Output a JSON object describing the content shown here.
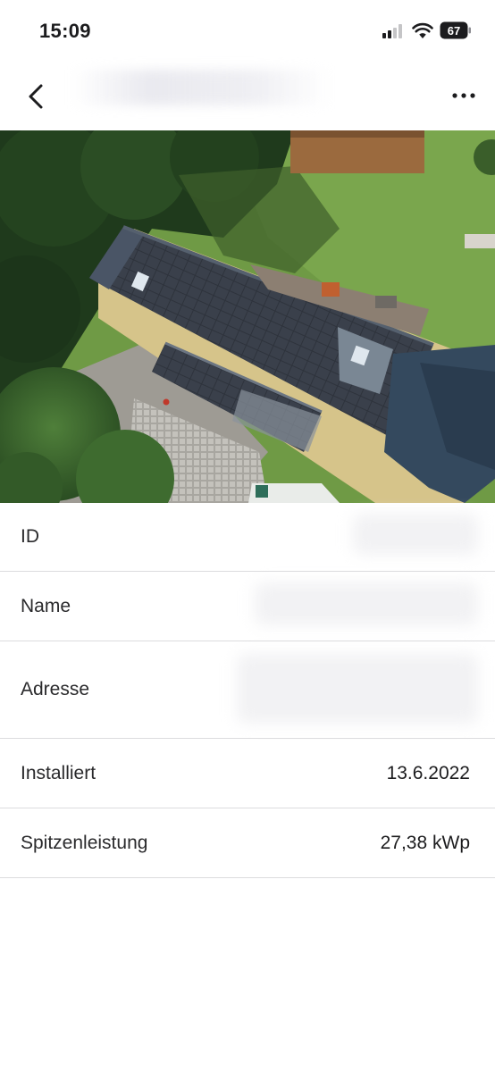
{
  "status_bar": {
    "time": "15:09",
    "battery_level": "67",
    "signal_bars_active": 2,
    "signal_bars_total": 4
  },
  "nav": {
    "back_icon": "chevron-left-icon",
    "more_icon": "ellipsis-icon"
  },
  "hero": {
    "icon": "photo"
  },
  "details": {
    "rows": [
      {
        "label": "ID",
        "value": ""
      },
      {
        "label": "Name",
        "value": ""
      },
      {
        "label": "Adresse",
        "value": ""
      },
      {
        "label": "Installiert",
        "value": "13.6.2022"
      },
      {
        "label": "Spitzenleistung",
        "value": "27,38 kWp"
      }
    ]
  },
  "colors": {
    "divider": "#dcdcde",
    "text": "#1c1c1e",
    "label": "#2a2a2c",
    "lawn": "#6f9a45",
    "roof_panels": "#2f3540"
  }
}
